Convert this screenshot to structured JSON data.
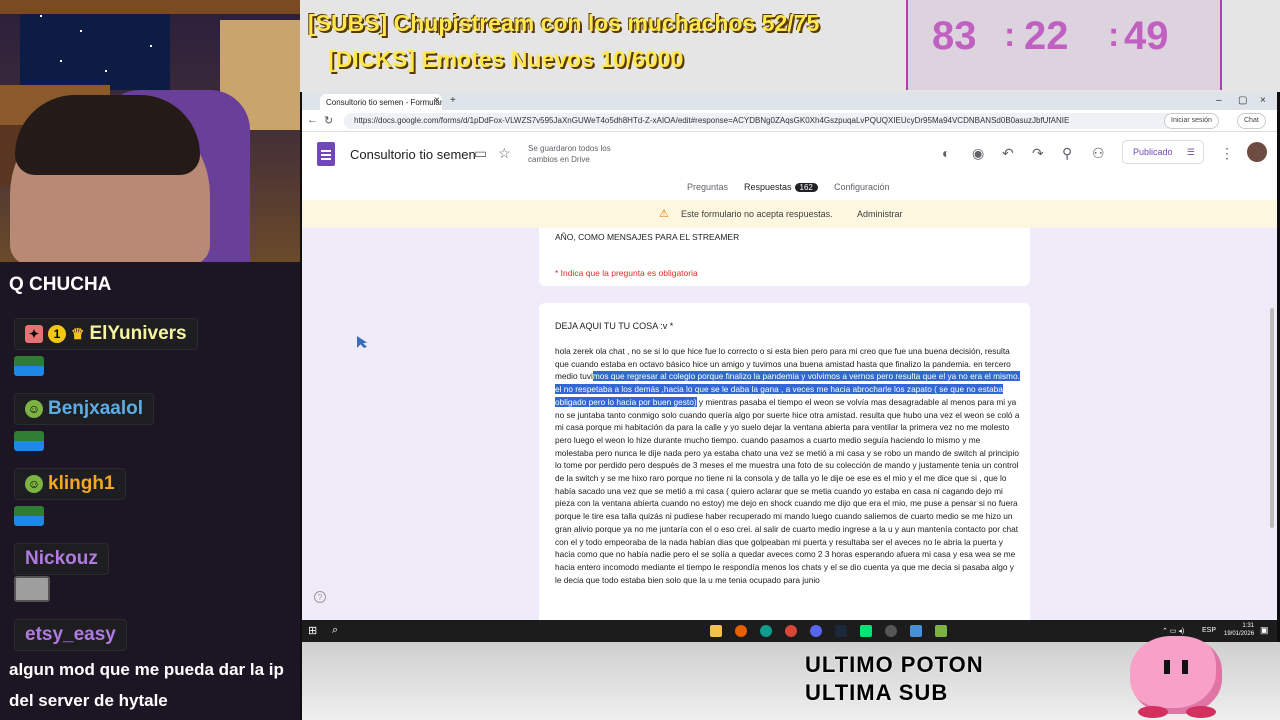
{
  "overlay": {
    "subs_goal": "[SUBS] Chupistream con los muchachos 52/75",
    "emote_goal": "[DICKS] Emotes Nuevos 10/6000",
    "timer": {
      "hours": "83",
      "minutes": "22",
      "seconds": "49",
      "sep": ":"
    }
  },
  "stream_chat": {
    "top_message": "Q CHUCHA",
    "users": [
      {
        "name": "ElYunivers",
        "color": "#f5f5a0"
      },
      {
        "name": "Benjxaalol",
        "color": "#5dade2"
      },
      {
        "name": "klingh1",
        "color": "#f5a623"
      },
      {
        "name": "Nickouz",
        "color": "#b07ae0"
      },
      {
        "name": "etsy_easy",
        "color": "#b07ae0"
      }
    ],
    "badge_number": "1",
    "bottom_message": "algun mod que me pueda dar la ip del server de hytale"
  },
  "browser": {
    "tab_title": "Consultorio tio semen - Formular",
    "url": "https://docs.google.com/forms/d/1pDdFox-VLWZS7v595JaXnGUWeT4o5dh8HTd-Z-xAIOA/edit#response=ACYDBNg0ZAqsGK0Xh4GszpuqaLvPQUQXIEUcyDr95Ma94VCDNBANSd0B0asuzJbfUfANIE",
    "signin_label": "Iniciar sesión",
    "chat_label": "Chat"
  },
  "form": {
    "title": "Consultorio tio semen",
    "saved_status": "Se guardaron todos los cambios en Drive",
    "publish_label": "Publicado",
    "tabs": {
      "questions": "Preguntas",
      "responses": "Respuestas",
      "responses_count": "162",
      "settings": "Configuración"
    },
    "warning": "Este formulario no acepta respuestas.",
    "manage_label": "Administrar",
    "description": "PODEIS DEJAR MENSAJES DE TODO TIPO, TANTO SI NECESITAIS AYUDA O DESAHOGAROS PARA ESTE FIN DE AÑO, COMO MENSAJES PARA EL STREAMER",
    "required_note": "* Indica que la pregunta es obligatoria",
    "question": "DEJA AQUI TU TU COSA :v *",
    "answer_pre": "hola zerek ola chat , no se si lo que hice fue lo correcto o si esta bien pero para mi creo que fue una buena decisión, resulta que cuando estaba en octavo básico hice un amigo y tuvimos una buena amistad hasta que finalizo la pandemia. en tercero medio tuvi",
    "answer_highlight": "mos que regresar al colegio porque finalizo la pandemia y volvimos a vernos pero resulta que el ya no era el mismo. el no respetaba a los demás ,hacia lo que se le daba la gana , a veces me hacia abrocharle los zapato ( se que no estaba obligado pero lo hacia por buen gesto)",
    "answer_post": " y mientras pasaba el tiempo el weon se volvía mas desagradable al menos para mi ya no se juntaba tanto conmigo solo cuando quería algo por suerte hice otra amistad. resulta que hubo una vez el weon se coló a mi casa porque mi habitación da para la calle y yo suelo dejar la ventana abierta para ventilar la primera vez no me molesto pero luego el weon lo hize durante mucho tiempo. cuando pasamos a cuarto medio seguía haciendo lo mismo y me molestaba pero nunca le dije nada pero ya estaba chato una vez se metió a mi casa y se robo un mando de switch al principio lo tome por perdido pero después de 3 meses el me muestra una foto de su colección de mando y justamente tenia un control de la switch y se me hixo raro porque no tiene ni la consola y de talla yo le dije oe ese es el mio y el me dice que si , que lo había sacado una vez que se metió a mi casa ( quiero aclarar que se metia cuando yo estaba en casa ni cagando dejo mi pieza con la ventana abierta cuando no estoy) me dejo en shock cuando me dijo que era el mio, me puse a pensar si no fuera porque le tire esa talla quizás ni pudiese haber recuperado mi mando luego cuando saliemos de cuarto medio se me hizo un gran alivio porque ya no me juntaría con el o eso crei. al salir de cuarto medio ingrese a la u y aun mantenía contacto por chat con el y todo empeoraba de la nada habían dias que golpeaban mi puerta y resultaba ser el aveces no le abria la puerta y hacia como que no había nadie pero el se solía a quedar aveces como 2 3 horas esperando afuera mi casa y esa wea se me hacia entero incomodo mediante el tiempo le respondía menos los chats y el se dio cuenta ya que me decia si pasaba algo y le decia que todo estaba bien solo que la u me tenia ocupado para junio"
  },
  "taskbar": {
    "lang": "ESP",
    "time": "1:31",
    "date": "19/01/2026"
  },
  "deco": {
    "line1": "ULTIMO POTON",
    "line2": "ULTIMA SUB"
  },
  "colors": {
    "forms_purple": "#7248b9",
    "highlight": "#3367d6",
    "timer": "#c060c0",
    "banner": "#ffe84d"
  }
}
